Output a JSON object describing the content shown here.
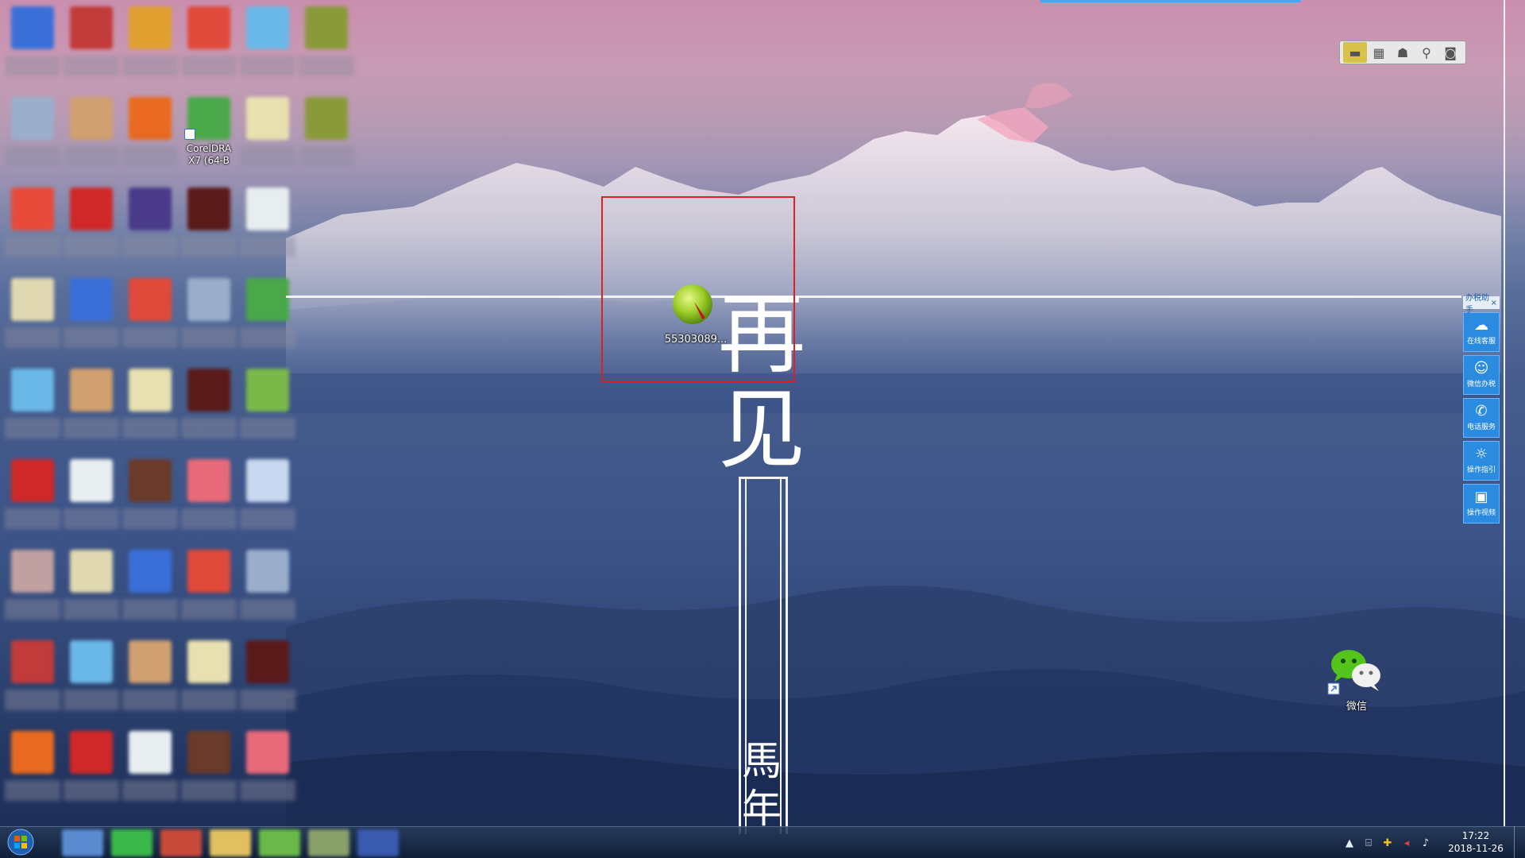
{
  "desktop": {
    "selected_icon": {
      "label": "55303089..."
    },
    "wechat_icon": {
      "label": "微信"
    },
    "calligraphy": {
      "char1": "再",
      "char2": "见",
      "char3": "馬",
      "char4": "年"
    },
    "left_icons": [
      {
        "label": "",
        "color": "#3a6fd8"
      },
      {
        "label": "",
        "color": "#c23b3b"
      },
      {
        "label": "",
        "color": "#e0a030"
      },
      {
        "label": "",
        "color": "#e04a3a"
      },
      {
        "label": "",
        "color": "#6ab8e8"
      },
      {
        "label": "",
        "color": "#8a9a3a"
      },
      {
        "label": "",
        "color": "#9aaecc"
      },
      {
        "label": "",
        "color": "#d0a070"
      },
      {
        "label": "",
        "color": "#e86a20"
      },
      {
        "label": "CorelDRA X7 (64-B",
        "color": "#4aa84a"
      },
      {
        "label": "",
        "color": "#e8e0b0"
      },
      {
        "label": "",
        "color": "#8a9a3a"
      },
      {
        "label": "",
        "color": "#e84a3a"
      },
      {
        "label": "",
        "color": "#d02828"
      },
      {
        "label": "",
        "color": "#4a3a8a"
      },
      {
        "label": "",
        "color": "#5a1a1a"
      },
      {
        "label": "",
        "color": "#e8eef0"
      }
    ]
  },
  "toolbar": {
    "tools": [
      {
        "icon": "note-icon",
        "glyph": "▬"
      },
      {
        "icon": "calendar-icon",
        "glyph": "▦"
      },
      {
        "icon": "contacts-icon",
        "glyph": "☗"
      },
      {
        "icon": "search-icon",
        "glyph": "⚲"
      },
      {
        "icon": "camera-icon",
        "glyph": "◙"
      }
    ]
  },
  "side_panel": {
    "title": "办税助手",
    "close": "×",
    "buttons": [
      {
        "icon": "customer-service-icon",
        "glyph": "☁",
        "label": "在线客服"
      },
      {
        "icon": "wechat-tax-icon",
        "glyph": "☺",
        "label": "微信办税"
      },
      {
        "icon": "phone-icon",
        "glyph": "✆",
        "label": "电话服务"
      },
      {
        "icon": "guide-bulb-icon",
        "glyph": "☼",
        "label": "操作指引"
      },
      {
        "icon": "video-icon",
        "glyph": "▣",
        "label": "操作视频"
      }
    ]
  },
  "taskbar": {
    "time": "17:22",
    "date": "2018-11-26",
    "apps": [
      {
        "color": "#5a8ad0"
      },
      {
        "color": "#3ab84a"
      },
      {
        "color": "#c84a3a"
      },
      {
        "color": "#e0c060"
      },
      {
        "color": "#6ab84a"
      },
      {
        "color": "#8aa06a"
      },
      {
        "color": "#3a5ab0"
      }
    ],
    "tray": [
      {
        "icon": "tray-expand-icon",
        "glyph": "▲"
      },
      {
        "icon": "network-icon",
        "glyph": "⌸"
      },
      {
        "icon": "security-icon",
        "glyph": "✚"
      },
      {
        "icon": "mute-flag-icon",
        "glyph": "◂"
      },
      {
        "icon": "volume-icon",
        "glyph": "♪"
      }
    ]
  },
  "colors": {
    "selection_border": "#e02020",
    "panel_blue": "#2a8be0",
    "top_bar_blue": "#4aa3ff"
  }
}
